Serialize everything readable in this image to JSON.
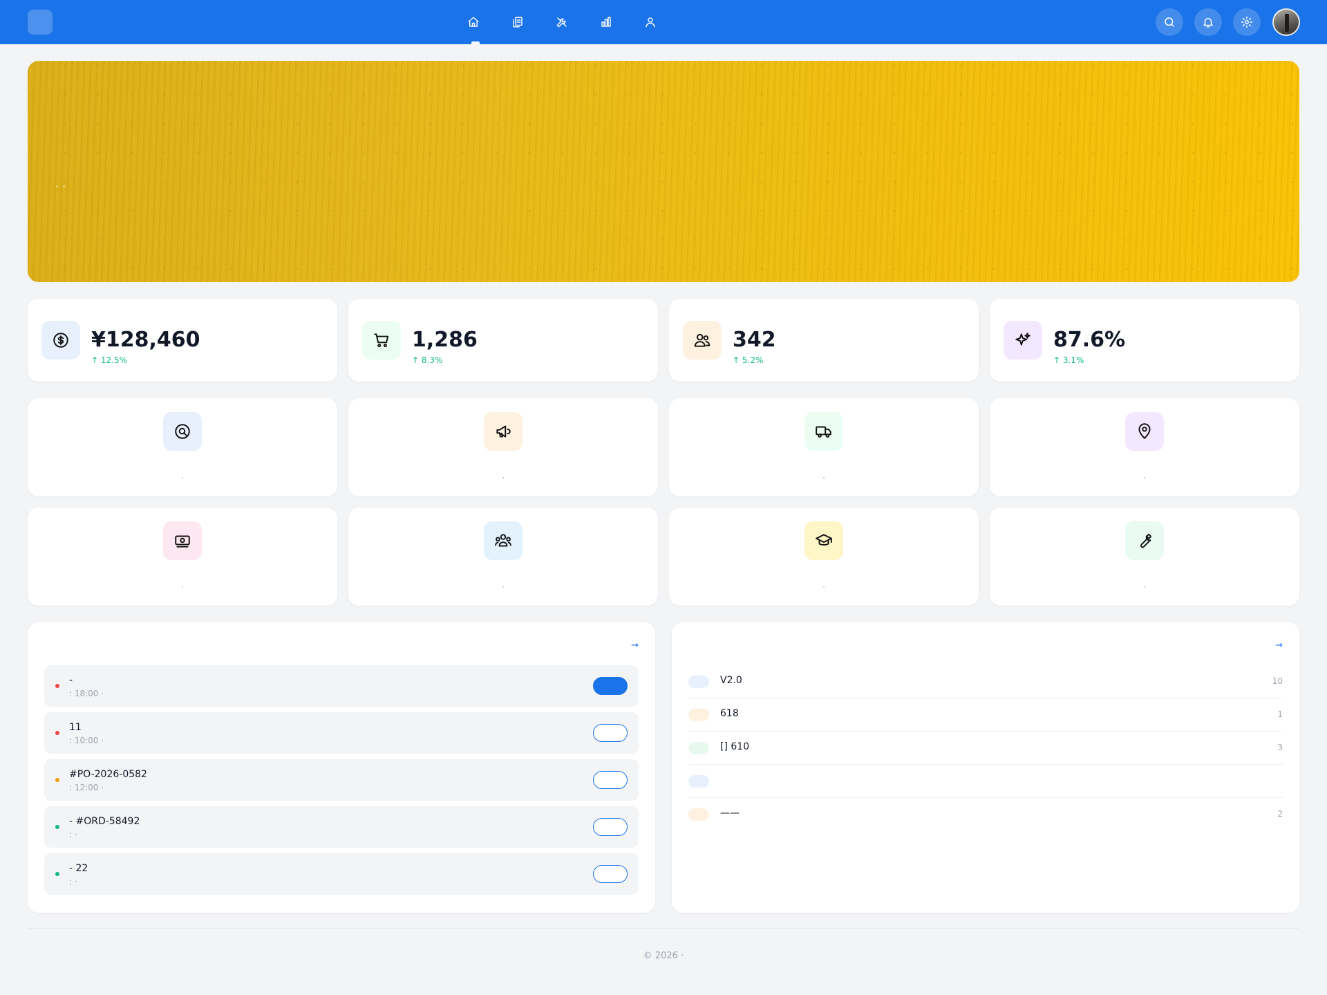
{
  "header": {
    "brand_glyph": "",
    "brand_name": "",
    "nav": [
      {
        "label": "",
        "active": true
      },
      {
        "label": ""
      },
      {
        "label": ""
      },
      {
        "label": ""
      },
      {
        "label": ""
      }
    ],
    "accent": "#1a73e8"
  },
  "hero": {
    "title": "",
    "subtitle": "· ·"
  },
  "stats": [
    {
      "label": "",
      "value": "¥128,460",
      "trend": "↑ 12.5%",
      "icon": "dollar-icon",
      "bg": "#e8f0fe"
    },
    {
      "label": "",
      "value": "1,286",
      "trend": "↑ 8.3%",
      "icon": "cart-icon",
      "bg": "#ecfdf3"
    },
    {
      "label": "",
      "value": "342",
      "trend": "↑ 5.2%",
      "icon": "users-icon",
      "bg": "#fff1e0"
    },
    {
      "label": "",
      "value": "87.6%",
      "trend": "↑ 3.1%",
      "icon": "sparkle-icon",
      "bg": "#f3e8ff"
    }
  ],
  "features": [
    {
      "name": "",
      "desc": "·",
      "icon": "search-icon",
      "bg": "#e8f0fe"
    },
    {
      "name": "",
      "desc": "·",
      "icon": "megaphone-icon",
      "bg": "#fff1e0"
    },
    {
      "name": "",
      "desc": "·",
      "icon": "truck-icon",
      "bg": "#ecfdf3"
    },
    {
      "name": "",
      "desc": "·",
      "icon": "location-icon",
      "bg": "#f3e8ff"
    },
    {
      "name": "",
      "desc": "·",
      "icon": "cash-icon",
      "bg": "#fde7f0"
    },
    {
      "name": "",
      "desc": "·",
      "icon": "team-icon",
      "bg": "#e3f2fd"
    },
    {
      "name": "",
      "desc": "·",
      "icon": "graduation-icon",
      "bg": "#fef6c7"
    },
    {
      "name": "",
      "desc": "·",
      "icon": "wrench-icon",
      "bg": "#e9fbf3"
    }
  ],
  "tasks_panel": {
    "title": "",
    "more": "→",
    "items": [
      {
        "title": "-",
        "meta": ": 18:00 ·",
        "dot": "#ef4444",
        "btn": "",
        "primary": true
      },
      {
        "title": "11",
        "meta": ": 10:00 ·",
        "dot": "#ef4444",
        "btn": ""
      },
      {
        "title": "#PO-2026-0582",
        "meta": ": 12:00 ·",
        "dot": "#f59e0b",
        "btn": ""
      },
      {
        "title": "- #ORD-58492",
        "meta": ": ·",
        "dot": "#10b981",
        "btn": ""
      },
      {
        "title": "- 22",
        "meta": ": ·",
        "dot": "#10b981",
        "btn": ""
      }
    ]
  },
  "notices_panel": {
    "title": "",
    "more": "→",
    "items": [
      {
        "tag": "",
        "text": "V2.0",
        "time": "10",
        "tag_bg": "#e8f0fe",
        "tag_fg": "#1a73e8"
      },
      {
        "tag": "",
        "text": "618",
        "time": "1",
        "tag_bg": "#fff1e0",
        "tag_fg": "#f97316"
      },
      {
        "tag": "",
        "text": "[] 610",
        "time": "3",
        "tag_bg": "#e7f8ef",
        "tag_fg": "#10b981"
      },
      {
        "tag": "",
        "text": "",
        "time": "",
        "tag_bg": "#e8f0fe",
        "tag_fg": "#1a73e8"
      },
      {
        "tag": "",
        "text": "——",
        "time": "2",
        "tag_bg": "#fff1e0",
        "tag_fg": "#f97316"
      }
    ]
  },
  "footer": {
    "text": "© 2026 ·"
  }
}
